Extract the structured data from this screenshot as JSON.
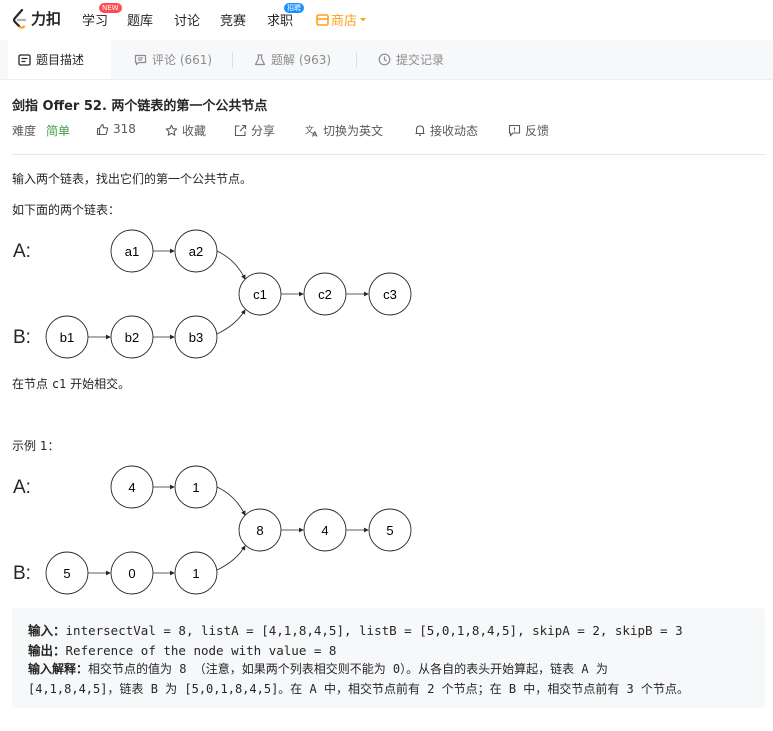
{
  "nav": {
    "brand": "力扣",
    "items": [
      {
        "label": "学习",
        "badge": "NEW"
      },
      {
        "label": "题库"
      },
      {
        "label": "讨论"
      },
      {
        "label": "竞赛"
      },
      {
        "label": "求职",
        "badge": "招聘"
      },
      {
        "label": "商店"
      }
    ]
  },
  "tabs": [
    {
      "label": "题目描述",
      "icon": "description-icon"
    },
    {
      "label": "评论 (661)",
      "icon": "comment-icon"
    },
    {
      "label": "题解 (963)",
      "icon": "flask-icon"
    },
    {
      "label": "提交记录",
      "icon": "clock-icon"
    }
  ],
  "problem": {
    "title": "剑指 Offer 52. 两个链表的第一个公共节点",
    "difficulty_label": "难度",
    "difficulty": "简单",
    "likes": "318",
    "actions": [
      "收藏",
      "分享",
      "切换为英文",
      "接收动态",
      "反馈"
    ]
  },
  "description": {
    "line1": "输入两个链表，找出它们的第一个公共节点。",
    "line2": "如下面的两个链表：",
    "line3_prefix": "在节点 ",
    "line3_code": "c1",
    "line3_suffix": " 开始相交。",
    "example_title": "示例 1："
  },
  "diagram1": {
    "label_a": "A:",
    "label_b": "B:",
    "list_a": [
      "a1",
      "a2"
    ],
    "list_b": [
      "b1",
      "b2",
      "b3"
    ],
    "shared": [
      "c1",
      "c2",
      "c3"
    ]
  },
  "diagram2": {
    "label_a": "A:",
    "label_b": "B:",
    "list_a": [
      "4",
      "1"
    ],
    "list_b": [
      "5",
      "0",
      "1"
    ],
    "shared": [
      "8",
      "4",
      "5"
    ]
  },
  "example": {
    "input_label": "输入",
    "input_value": "intersectVal = 8, listA = [4,1,8,4,5], listB = [5,0,1,8,4,5], skipA = 2, skipB = 3",
    "output_label": "输出",
    "output_value": "Reference of the node with value = 8",
    "explain_label": "输入解释",
    "explain_line1": "相交节点的值为 8 （注意，如果两个列表相交则不能为 0）。从各自的表头开始算起，链表 A 为",
    "explain_line2": "[4,1,8,4,5]，链表 B 为 [5,0,1,8,4,5]。在 A 中，相交节点前有 2 个节点；在 B 中，相交节点前有 3 个节点。"
  },
  "colors": {
    "accent": "#ffa116",
    "easy": "#43a047",
    "new_badge": "#ff4d4f",
    "hire_badge": "#1890ff"
  }
}
